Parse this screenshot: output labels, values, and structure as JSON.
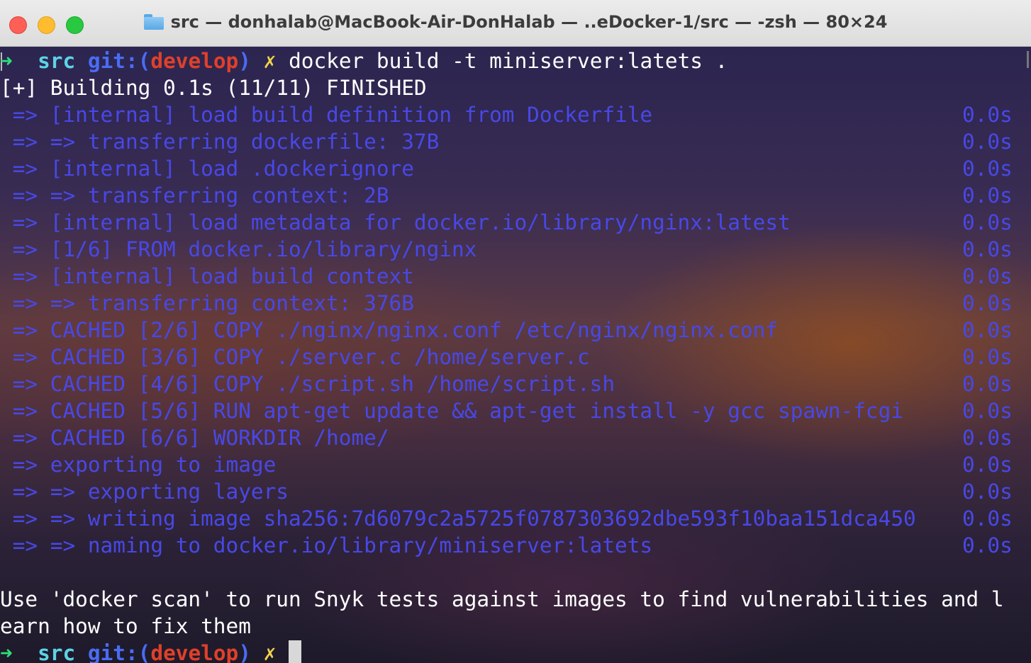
{
  "window": {
    "title": "src — donhalab@MacBook-Air-DonHalab — ..eDocker-1/src — -zsh — 80×24",
    "title_icon": "folder-icon"
  },
  "prompt": {
    "arrow": "➜",
    "dir": "src",
    "git_label": "git:(",
    "branch": "develop",
    "git_close": ")",
    "dirty_mark": "✗",
    "command": "docker build -t miniserver:latets ."
  },
  "build_header": "[+] Building 0.1s (11/11) FINISHED",
  "steps": [
    {
      "text": " => [internal] load build definition from Dockerfile",
      "time": "0.0s"
    },
    {
      "text": " => => transferring dockerfile: 37B",
      "time": "0.0s"
    },
    {
      "text": " => [internal] load .dockerignore",
      "time": "0.0s"
    },
    {
      "text": " => => transferring context: 2B",
      "time": "0.0s"
    },
    {
      "text": " => [internal] load metadata for docker.io/library/nginx:latest",
      "time": "0.0s"
    },
    {
      "text": " => [1/6] FROM docker.io/library/nginx",
      "time": "0.0s"
    },
    {
      "text": " => [internal] load build context",
      "time": "0.0s"
    },
    {
      "text": " => => transferring context: 376B",
      "time": "0.0s"
    },
    {
      "text": " => CACHED [2/6] COPY ./nginx/nginx.conf /etc/nginx/nginx.conf",
      "time": "0.0s"
    },
    {
      "text": " => CACHED [3/6] COPY ./server.c /home/server.c",
      "time": "0.0s"
    },
    {
      "text": " => CACHED [4/6] COPY ./script.sh /home/script.sh",
      "time": "0.0s"
    },
    {
      "text": " => CACHED [5/6] RUN apt-get update && apt-get install -y gcc spawn-fcgi",
      "time": "0.0s"
    },
    {
      "text": " => CACHED [6/6] WORKDIR /home/",
      "time": "0.0s"
    },
    {
      "text": " => exporting to image",
      "time": "0.0s"
    },
    {
      "text": " => => exporting layers",
      "time": "0.0s"
    },
    {
      "text": " => => writing image sha256:7d6079c2a5725f0787303692dbe593f10baa151dca450",
      "time": "0.0s"
    },
    {
      "text": " => => naming to docker.io/library/miniserver:latets",
      "time": "0.0s"
    }
  ],
  "scan_message": [
    "Use 'docker scan' to run Snyk tests against images to find vulnerabilities and l",
    "earn how to fix them"
  ],
  "colors": {
    "step_text": "#4848e8",
    "prompt_arrow": "#2ee07a",
    "dir": "#5ed2e6",
    "git": "#4a6cf5",
    "branch": "#e0402a",
    "dirty_mark": "#f0d24a"
  }
}
